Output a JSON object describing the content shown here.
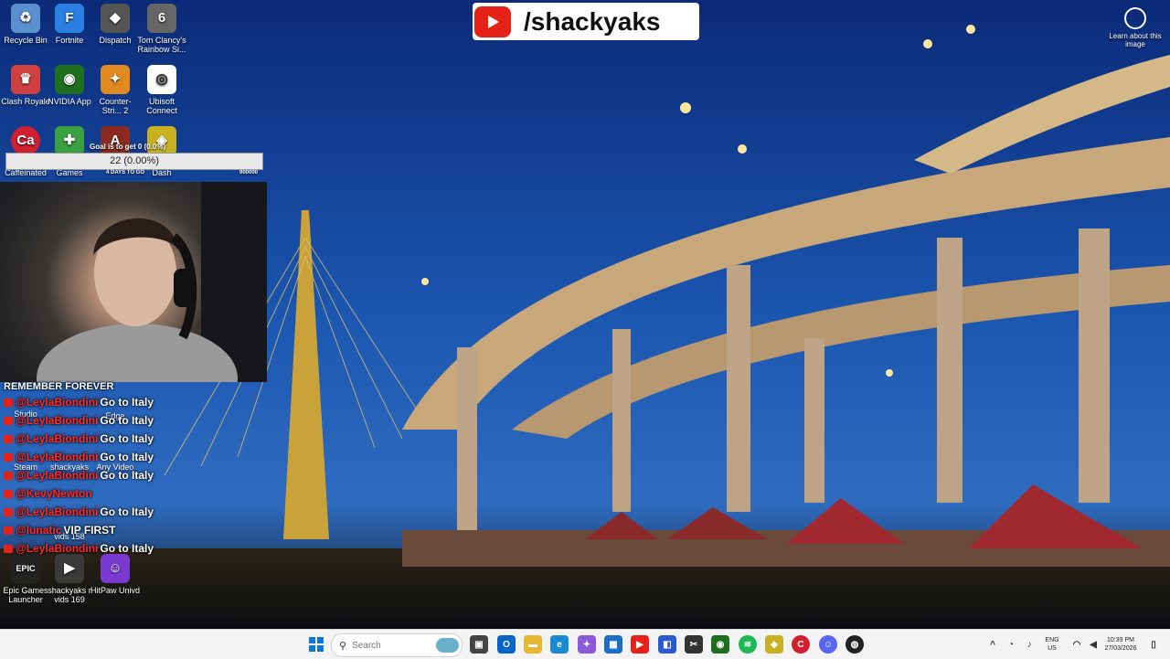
{
  "desktop_icons": [
    {
      "label": "Recycle Bin",
      "color": "#5a8fd0",
      "glyph": "♻"
    },
    {
      "label": "Fortnite",
      "color": "#2b7fe0",
      "glyph": "F"
    },
    {
      "label": "Dispatch",
      "color": "#555555",
      "glyph": "◆"
    },
    {
      "label": "Tom Clancy's Rainbow Si...",
      "color": "#666666",
      "glyph": "6"
    },
    {
      "label": "Clash Royale",
      "color": "#d04040",
      "glyph": "♛"
    },
    {
      "label": "NVIDIA App",
      "color": "#1e6e1e",
      "glyph": "◉"
    },
    {
      "label": "Counter-Stri... 2",
      "color": "#e08a20",
      "glyph": "✦"
    },
    {
      "label": "Ubisoft Connect",
      "color": "#ffffff",
      "glyph": "◎"
    },
    {
      "label": "Caffeinated",
      "color": "#d02030",
      "glyph": "Ca"
    },
    {
      "label": "Games",
      "color": "#3aa040",
      "glyph": "✚"
    },
    {
      "label": "4 DAYS TO GO",
      "color": "#8a2a20",
      "glyph": "A"
    },
    {
      "label": "Dash",
      "color": "#c8b020",
      "glyph": "◈"
    },
    {
      "label": "Studio",
      "color": "#444444",
      "glyph": ""
    },
    {
      "label": "Edge",
      "color": "#1a8ad0",
      "glyph": ""
    },
    {
      "label": "Steam",
      "color": "#1b2838",
      "glyph": ""
    },
    {
      "label": "shackyaks",
      "color": "#333333",
      "glyph": ""
    },
    {
      "label": "Any Video",
      "color": "#3a6ed0",
      "glyph": ""
    },
    {
      "label": "vids 158",
      "color": "#444444",
      "glyph": ""
    },
    {
      "label": "Epic Games Launcher",
      "color": "#222222",
      "glyph": "EPIC"
    },
    {
      "label": "shackyaks r vids 169",
      "color": "#3a3a3a",
      "glyph": "▶"
    },
    {
      "label": "HitPaw Univd",
      "color": "#7a3ad0",
      "glyph": "☺"
    }
  ],
  "youtube_banner": {
    "handle": "/shackyaks"
  },
  "learn_about": {
    "label": "Learn about this image"
  },
  "goal": {
    "title": "Goal is to get 0 (0.0%)",
    "value_text": "22 (0.00%)",
    "fill_fraction": 0.0,
    "left_label": "4 DAYS TO GO",
    "right_label": "900000"
  },
  "chat": {
    "header": "REMEMBER FOREVER",
    "messages": [
      {
        "user": "@LeylaBiondini",
        "text": "Go to Italy"
      },
      {
        "user": "@LeylaBiondini",
        "text": "Go to Italy"
      },
      {
        "user": "@LeylaBiondini",
        "text": "Go to Italy"
      },
      {
        "user": "@LeylaBiondini",
        "text": "Go to Italy"
      },
      {
        "user": "@LeylaBiondini",
        "text": "Go to Italy"
      },
      {
        "user": "@KevyNewton",
        "text": ""
      },
      {
        "user": "@LeylaBiondini",
        "text": "Go to Italy"
      },
      {
        "user": "@lunatic",
        "text": "VIP FIRST"
      },
      {
        "user": "@LeylaBiondini",
        "text": "Go to Italy"
      }
    ]
  },
  "taskbar": {
    "search_placeholder": "Search",
    "tray_lang": "ENG",
    "tray_region": "US",
    "clock_time": "10:39 PM",
    "clock_date": "27/03/2026"
  }
}
